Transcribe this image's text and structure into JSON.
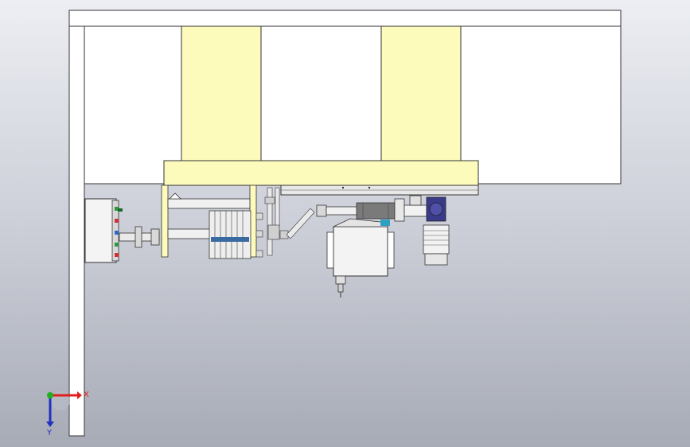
{
  "viewport": {
    "colors": {
      "background_top": "#eceef3",
      "background_bottom": "#a7abb6",
      "frame_fill": "#ffffff",
      "frame_stroke": "#333333",
      "highlight_fill": "#fdfbbc",
      "component_gray": "#d8d8d8",
      "motor_blue": "#3a3a8a",
      "axis_x": "#e0201c",
      "axis_y": "#2030c0",
      "axis_origin": "#20b020"
    }
  },
  "triad": {
    "x_label": "X",
    "y_label": "Y"
  }
}
